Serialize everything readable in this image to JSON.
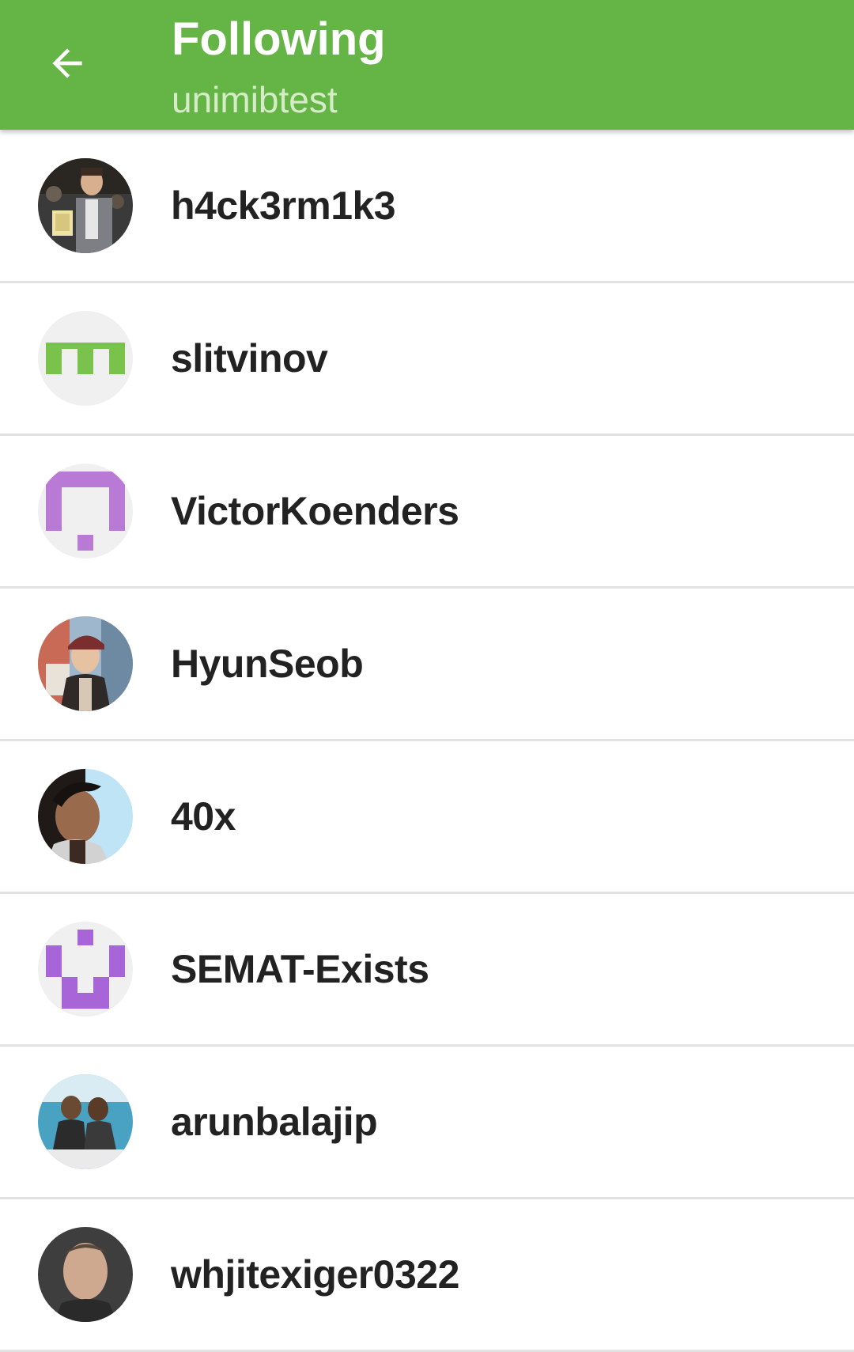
{
  "appbar": {
    "title": "Following",
    "subtitle": "unimibtest",
    "back_icon": "arrow-back-icon",
    "color": "#65b446"
  },
  "following": [
    {
      "username": "h4ck3rm1k3",
      "avatar": "photo"
    },
    {
      "username": "slitvinov",
      "avatar": "identicon",
      "color": "#79c24c"
    },
    {
      "username": "VictorKoenders",
      "avatar": "identicon",
      "color": "#b97ad6"
    },
    {
      "username": "HyunSeob",
      "avatar": "photo"
    },
    {
      "username": "40x",
      "avatar": "photo"
    },
    {
      "username": "SEMAT-Exists",
      "avatar": "identicon",
      "color": "#a765d8"
    },
    {
      "username": "arunbalajip",
      "avatar": "photo"
    },
    {
      "username": "whjitexiger0322",
      "avatar": "photo"
    }
  ]
}
